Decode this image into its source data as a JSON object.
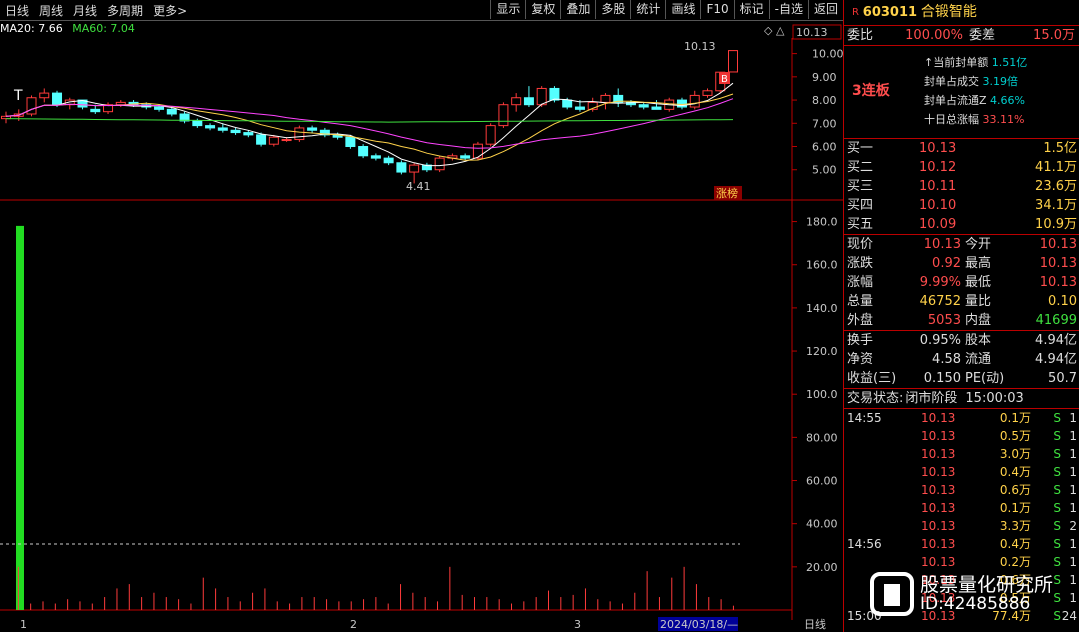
{
  "toolbar": {
    "left": [
      "日线",
      "周线",
      "月线",
      "多周期",
      "更多>"
    ],
    "right": [
      "显示",
      "复权",
      "叠加",
      "多股",
      "统计",
      "画线",
      "F10",
      "标记",
      "-自选",
      "返回"
    ]
  },
  "ma_legend": {
    "ma20": "MA20: 7.66",
    "ma60": "MA60: 7.04"
  },
  "price_axis": [
    "10.00",
    "9.00",
    "8.00",
    "7.00",
    "6.00",
    "5.00"
  ],
  "vol_axis": [
    "180.0",
    "160.0",
    "140.0",
    "120.0",
    "100.0",
    "80.00",
    "60.00",
    "40.00",
    "20.00"
  ],
  "annotations": {
    "high": "10.13",
    "low": "4.41",
    "current": "10.13",
    "tag": "涨榜",
    "b": "B",
    "t": "T"
  },
  "bottom_axis": {
    "m1": "1",
    "m2": "2",
    "m3": "3",
    "date": "2024/03/18/—",
    "period": "日线"
  },
  "stock": {
    "r": "R",
    "code": "603011",
    "name": "合锻智能"
  },
  "wei": {
    "bi_label": "委比",
    "bi": "100.00%",
    "cha_label": "委差",
    "cha": "15.0万"
  },
  "seal": {
    "label": "3连板",
    "items": [
      {
        "k": "↑当前封单额",
        "v": "1.51亿"
      },
      {
        "k": "封单占成交",
        "v": "3.19倍"
      },
      {
        "k": "封单占流通Z",
        "v": "4.66%"
      },
      {
        "k": "十日总涨幅",
        "v": "33.11%"
      }
    ]
  },
  "buy": [
    {
      "k": "买一",
      "p": "10.13",
      "v": "1.5亿"
    },
    {
      "k": "买二",
      "p": "10.12",
      "v": "41.1万"
    },
    {
      "k": "买三",
      "p": "10.11",
      "v": "23.6万"
    },
    {
      "k": "买四",
      "p": "10.10",
      "v": "34.1万"
    },
    {
      "k": "买五",
      "p": "10.09",
      "v": "10.9万"
    }
  ],
  "quote": [
    {
      "k1": "现价",
      "v1": "10.13",
      "k2": "今开",
      "v2": "10.13"
    },
    {
      "k1": "涨跌",
      "v1": "0.92",
      "k2": "最高",
      "v2": "10.13"
    },
    {
      "k1": "涨幅",
      "v1": "9.99%",
      "k2": "最低",
      "v2": "10.13"
    },
    {
      "k1": "总量",
      "v1": "46752",
      "k2": "量比",
      "v2": "0.10"
    },
    {
      "k1": "外盘",
      "v1": "5053",
      "k2": "内盘",
      "v2": "41699"
    }
  ],
  "fund": [
    {
      "k1": "换手",
      "v1": "0.95%",
      "k2": "股本",
      "v2": "4.94亿"
    },
    {
      "k1": "净资",
      "v1": "4.58",
      "k2": "流通",
      "v2": "4.94亿"
    },
    {
      "k1": "收益(三)",
      "v1": "0.150",
      "k2": "PE(动)",
      "v2": "50.7"
    }
  ],
  "status": {
    "label": "交易状态:",
    "val": "闭市阶段",
    "time": "15:00:03"
  },
  "ticks": [
    {
      "t": "14:55",
      "p": "10.13",
      "v": "0.1万",
      "s": "S",
      "n": "1"
    },
    {
      "t": "",
      "p": "10.13",
      "v": "0.5万",
      "s": "S",
      "n": "1"
    },
    {
      "t": "",
      "p": "10.13",
      "v": "3.0万",
      "s": "S",
      "n": "1"
    },
    {
      "t": "",
      "p": "10.13",
      "v": "0.4万",
      "s": "S",
      "n": "1"
    },
    {
      "t": "",
      "p": "10.13",
      "v": "0.6万",
      "s": "S",
      "n": "1"
    },
    {
      "t": "",
      "p": "10.13",
      "v": "0.1万",
      "s": "S",
      "n": "1"
    },
    {
      "t": "",
      "p": "10.13",
      "v": "3.3万",
      "s": "S",
      "n": "2"
    },
    {
      "t": "14:56",
      "p": "10.13",
      "v": "0.4万",
      "s": "S",
      "n": "1"
    },
    {
      "t": "",
      "p": "10.13",
      "v": "0.2万",
      "s": "S",
      "n": "1"
    },
    {
      "t": "",
      "p": "10.13",
      "v": "0.6万",
      "s": "S",
      "n": "1"
    },
    {
      "t": "",
      "p": "10.13",
      "v": "0.5万",
      "s": "S",
      "n": "1"
    },
    {
      "t": "15:00",
      "p": "10.13",
      "v": "77.4万",
      "s": "S",
      "n": "24"
    }
  ],
  "watermark": {
    "line1": "股票量化研究所",
    "line2": "ID:42485886"
  },
  "chart_data": {
    "type": "candlestick",
    "ylim": [
      4.0,
      10.5
    ],
    "candles": [
      [
        7.2,
        7.5,
        7.0,
        7.3
      ],
      [
        7.3,
        7.6,
        7.1,
        7.4
      ],
      [
        7.4,
        8.2,
        7.3,
        8.1
      ],
      [
        8.1,
        8.5,
        7.9,
        8.3
      ],
      [
        8.3,
        8.4,
        7.7,
        7.8
      ],
      [
        7.8,
        8.1,
        7.6,
        8.0
      ],
      [
        8.0,
        8.0,
        7.6,
        7.7
      ],
      [
        7.6,
        7.8,
        7.4,
        7.5
      ],
      [
        7.5,
        7.9,
        7.4,
        7.8
      ],
      [
        7.8,
        8.0,
        7.7,
        7.9
      ],
      [
        7.9,
        8.0,
        7.7,
        7.8
      ],
      [
        7.8,
        7.9,
        7.6,
        7.7
      ],
      [
        7.7,
        7.8,
        7.5,
        7.6
      ],
      [
        7.6,
        7.7,
        7.3,
        7.4
      ],
      [
        7.4,
        7.5,
        7.0,
        7.1
      ],
      [
        7.1,
        7.2,
        6.8,
        6.9
      ],
      [
        6.9,
        7.0,
        6.7,
        6.8
      ],
      [
        6.8,
        7.0,
        6.6,
        6.7
      ],
      [
        6.7,
        6.8,
        6.5,
        6.6
      ],
      [
        6.6,
        6.7,
        6.4,
        6.5
      ],
      [
        6.5,
        6.6,
        6.0,
        6.1
      ],
      [
        6.1,
        6.5,
        6.0,
        6.4
      ],
      [
        6.3,
        6.4,
        6.2,
        6.3
      ],
      [
        6.3,
        6.9,
        6.2,
        6.8
      ],
      [
        6.8,
        6.9,
        6.6,
        6.7
      ],
      [
        6.7,
        6.8,
        6.4,
        6.5
      ],
      [
        6.5,
        6.6,
        6.3,
        6.4
      ],
      [
        6.4,
        6.5,
        5.9,
        6.0
      ],
      [
        6.0,
        6.1,
        5.5,
        5.6
      ],
      [
        5.6,
        5.7,
        5.4,
        5.5
      ],
      [
        5.5,
        5.6,
        5.2,
        5.3
      ],
      [
        5.3,
        5.4,
        4.8,
        4.9
      ],
      [
        4.9,
        5.3,
        4.41,
        5.2
      ],
      [
        5.2,
        5.3,
        4.9,
        5.0
      ],
      [
        5.0,
        5.6,
        4.9,
        5.5
      ],
      [
        5.5,
        5.7,
        5.4,
        5.6
      ],
      [
        5.6,
        5.7,
        5.4,
        5.5
      ],
      [
        5.5,
        6.2,
        5.4,
        6.1
      ],
      [
        6.1,
        7.0,
        6.0,
        6.9
      ],
      [
        6.9,
        7.9,
        6.8,
        7.8
      ],
      [
        7.8,
        8.3,
        7.5,
        8.1
      ],
      [
        8.1,
        8.6,
        7.7,
        7.8
      ],
      [
        7.8,
        8.6,
        7.7,
        8.5
      ],
      [
        8.5,
        8.6,
        7.9,
        8.0
      ],
      [
        8.0,
        8.1,
        7.6,
        7.7
      ],
      [
        7.7,
        8.0,
        7.5,
        7.6
      ],
      [
        7.6,
        8.1,
        7.5,
        7.9
      ],
      [
        7.9,
        8.3,
        7.6,
        8.2
      ],
      [
        8.2,
        8.5,
        7.7,
        7.9
      ],
      [
        7.9,
        8.0,
        7.7,
        7.8
      ],
      [
        7.8,
        7.9,
        7.6,
        7.7
      ],
      [
        7.7,
        8.0,
        7.6,
        7.6
      ],
      [
        7.6,
        8.1,
        7.5,
        8.0
      ],
      [
        8.0,
        8.1,
        7.6,
        7.7
      ],
      [
        7.7,
        8.4,
        7.6,
        8.2
      ],
      [
        8.2,
        8.5,
        8.1,
        8.4
      ],
      [
        8.4,
        9.2,
        8.3,
        9.2
      ],
      [
        9.21,
        10.13,
        9.21,
        10.13
      ]
    ],
    "volume_ylim": [
      0,
      190
    ],
    "volumes": [
      178,
      20,
      3,
      4,
      3,
      5,
      4,
      3,
      6,
      10,
      12,
      6,
      8,
      6,
      5,
      3,
      15,
      10,
      6,
      4,
      8,
      10,
      4,
      3,
      6,
      6,
      5,
      4,
      4,
      5,
      6,
      3,
      12,
      8,
      6,
      4,
      20,
      7,
      6,
      6,
      5,
      3,
      4,
      6,
      9,
      6,
      7,
      10,
      5,
      4,
      3,
      8,
      18,
      6,
      15,
      20,
      12,
      6,
      5,
      2
    ]
  }
}
